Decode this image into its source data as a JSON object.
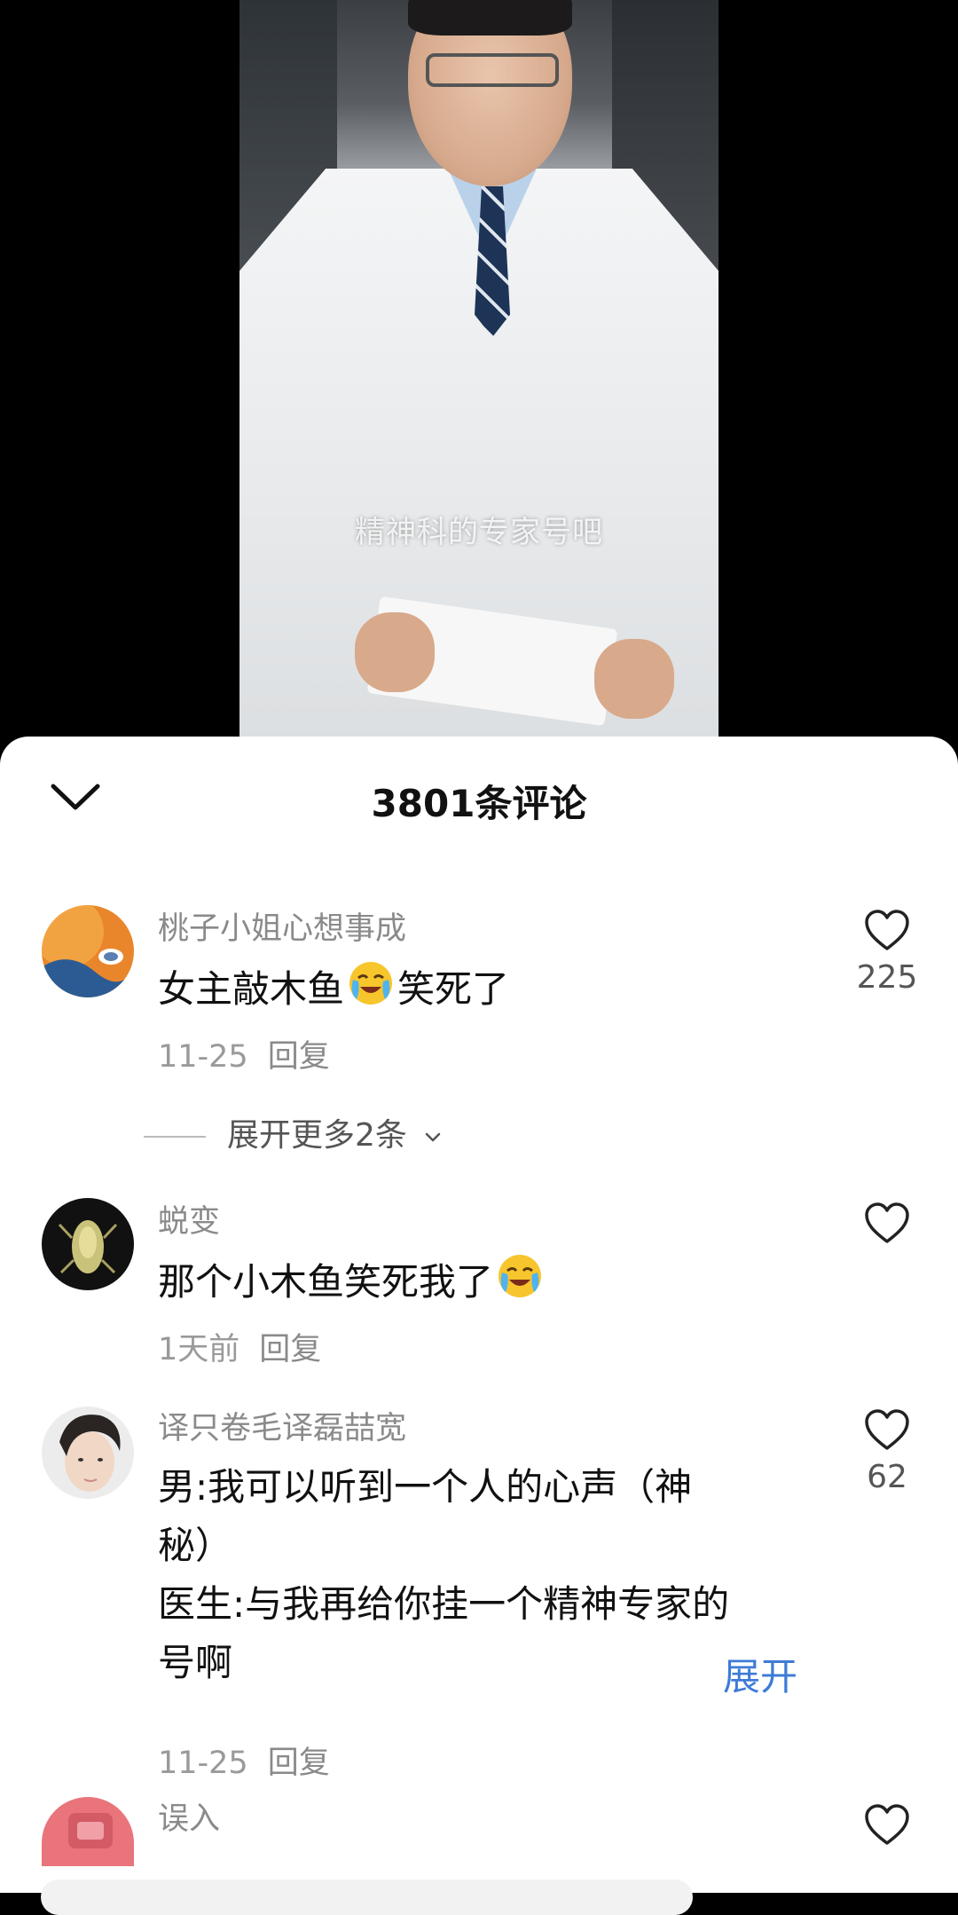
{
  "video": {
    "subtitle": "精神科的专家号吧"
  },
  "panel": {
    "title": "3801条评论"
  },
  "comments": [
    {
      "author": "桃子小姐心想事成",
      "text_before": "女主敲木鱼",
      "emoji": "crying-laughing",
      "text_after": "笑死了",
      "date": "11-25",
      "reply": "回复",
      "likes": "225"
    },
    {
      "author": "蜕变",
      "text_before": "那个小木鱼笑死我了",
      "emoji": "crying-laughing",
      "date": "1天前",
      "reply": "回复",
      "likes": ""
    },
    {
      "author": "译只卷毛译磊喆宽",
      "line1": "男:我可以听到一个人的心声（神",
      "line2": "秘）",
      "line3": "医生:与我再给你挂一个精神专家的",
      "line4": "号啊",
      "expand": "展开",
      "date": "11-25",
      "reply": "回复",
      "likes": "62"
    },
    {
      "author": "误入",
      "likes": ""
    }
  ],
  "expand_more": "展开更多2条",
  "colors": {
    "link": "#3d7bd6",
    "muted": "#8a8a8a",
    "text": "#111111"
  }
}
